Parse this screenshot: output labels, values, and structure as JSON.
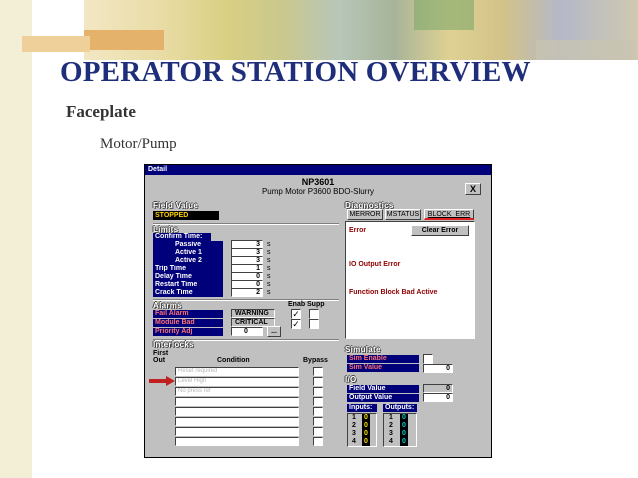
{
  "slide": {
    "title": "OPERATOR STATION OVERVIEW",
    "subtitle": "Faceplate",
    "subsubtitle": "Motor/Pump"
  },
  "window": {
    "title": "Detail",
    "tag": "NP3601",
    "description": "Pump Motor P3600 BDO-Slurry",
    "close_label": "X"
  },
  "field_value": {
    "header": "Field Value",
    "status": "STOPPED"
  },
  "limits": {
    "header": "Limits",
    "rows": [
      {
        "label": "Confirm Time:",
        "value": "",
        "unit": ""
      },
      {
        "label": "Passive",
        "value": "3",
        "unit": "s"
      },
      {
        "label": "Active 1",
        "value": "3",
        "unit": "s"
      },
      {
        "label": "Active 2",
        "value": "3",
        "unit": "s"
      },
      {
        "label": "Trip Time",
        "value": "1",
        "unit": "s"
      },
      {
        "label": "Delay Time",
        "value": "0",
        "unit": "s"
      },
      {
        "label": "Restart Time",
        "value": "0",
        "unit": "s"
      },
      {
        "label": "Crack Time",
        "value": "2",
        "unit": "s"
      }
    ]
  },
  "alarms": {
    "header": "Alarms",
    "enab_label": "Enab",
    "supp_label": "Supp",
    "rows": [
      {
        "label": "Fail Alarm",
        "value": "WARNING",
        "enab": "✓",
        "supp": ""
      },
      {
        "label": "Module Bad",
        "value": "CRITICAL",
        "enab": "✓",
        "supp": ""
      },
      {
        "label": "Priority Adj",
        "value": "0",
        "button": "..."
      }
    ]
  },
  "interlocks": {
    "header": "Interlocks",
    "first_out_label": "First\nOut",
    "condition_label": "Condition",
    "bypass_label": "Bypass",
    "rows": [
      "Reset required",
      "Level High",
      "No press ref",
      "",
      "",
      "",
      "",
      ""
    ]
  },
  "diagnostics": {
    "header": "Diagnostics",
    "tabs": [
      "MERROR",
      "MSTATUS",
      "BLOCK_ERR"
    ],
    "selected_tab": "BLOCK_ERR",
    "error_label": "Error",
    "clear_button": "Clear Error",
    "io_output_error": "IO Output Error",
    "function_block": "Function Block Bad Active"
  },
  "simulate": {
    "header": "Simulate",
    "enable_label": "Sim Enable",
    "value_label": "Sim Value",
    "value": "0"
  },
  "io": {
    "header": "I/O",
    "field_value_label": "Field Value",
    "field_value": "0",
    "output_value_label": "Output Value",
    "output_value": "0",
    "inputs_label": "Inputs:",
    "outputs_label": "Outputs:",
    "inputs": [
      {
        "n": "1",
        "v": "0"
      },
      {
        "n": "2",
        "v": "0"
      },
      {
        "n": "3",
        "v": "0"
      },
      {
        "n": "4",
        "v": "0"
      }
    ],
    "outputs": [
      {
        "n": "1",
        "v": "0"
      },
      {
        "n": "2",
        "v": "0"
      },
      {
        "n": "3",
        "v": "0"
      },
      {
        "n": "4",
        "v": "0"
      }
    ]
  },
  "colors": {
    "title": "#1f2e7a",
    "label_bg": "#00007b",
    "status_text": "#ffd000",
    "input_led": "#ffe000",
    "output_led": "#00d0d0"
  }
}
